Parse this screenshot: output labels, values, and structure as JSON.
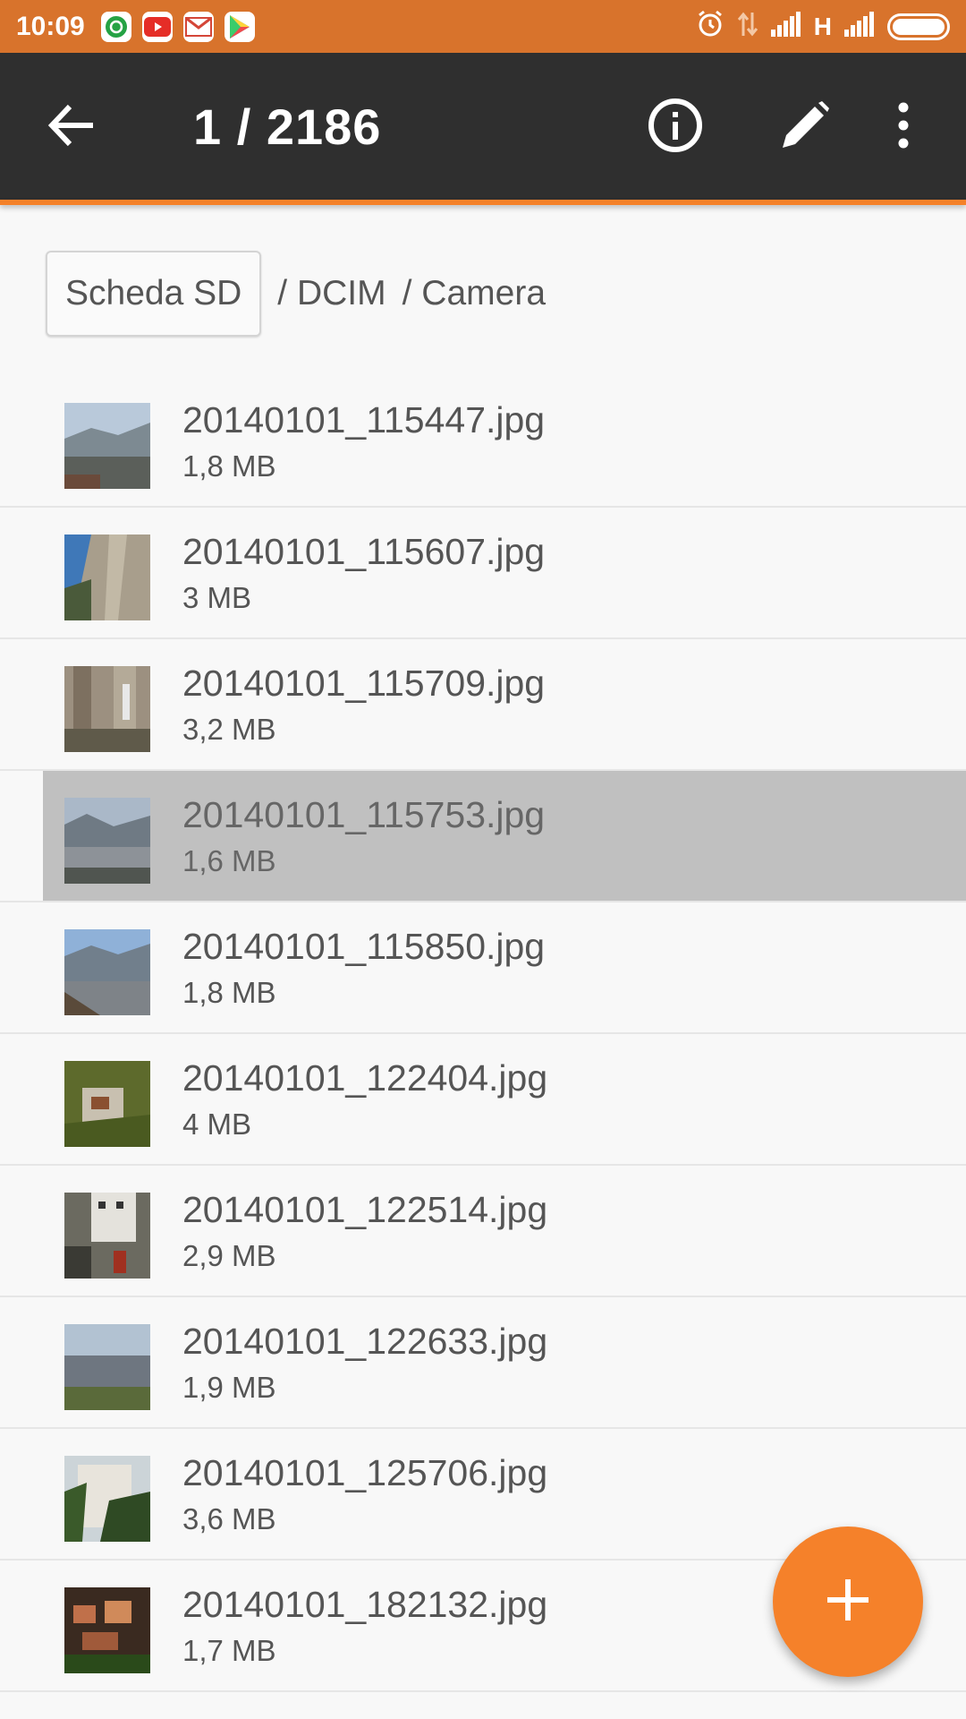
{
  "status_bar": {
    "time": "10:09",
    "network_label": "H",
    "colors": {
      "background": "#d8732c"
    },
    "icons": [
      "whatsapp-icon",
      "youtube-icon",
      "gmail-icon",
      "play-store-icon",
      "alarm-icon",
      "data-arrows-icon",
      "signal-icon",
      "battery-icon"
    ]
  },
  "toolbar": {
    "title": "1 / 2186",
    "icons": [
      "back-arrow-icon",
      "info-icon",
      "edit-pencil-icon",
      "more-vert-icon"
    ]
  },
  "breadcrumb": {
    "root": "Scheda SD",
    "parts": [
      "/ DCIM",
      "/ Camera"
    ]
  },
  "files": [
    {
      "name": "20140101_115447.jpg",
      "size": "1,8 MB"
    },
    {
      "name": "20140101_115607.jpg",
      "size": "3 MB"
    },
    {
      "name": "20140101_115709.jpg",
      "size": "3,2 MB"
    },
    {
      "name": "20140101_115753.jpg",
      "size": "1,6 MB",
      "selected": true
    },
    {
      "name": "20140101_115850.jpg",
      "size": "1,8 MB"
    },
    {
      "name": "20140101_122404.jpg",
      "size": "4 MB"
    },
    {
      "name": "20140101_122514.jpg",
      "size": "2,9 MB"
    },
    {
      "name": "20140101_122633.jpg",
      "size": "1,9 MB"
    },
    {
      "name": "20140101_125706.jpg",
      "size": "3,6 MB"
    },
    {
      "name": "20140101_182132.jpg",
      "size": "1,7 MB"
    }
  ],
  "fab": {
    "label": "+",
    "icon": "add-icon"
  },
  "colors": {
    "accent": "#f5812a",
    "toolbar": "#2f2f2f",
    "selected_row": "#c0c0c0"
  }
}
